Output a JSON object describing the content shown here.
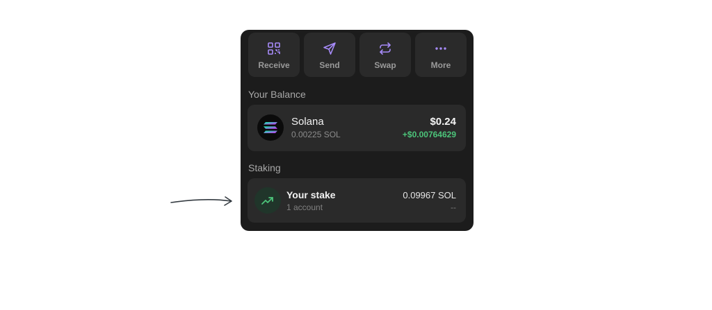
{
  "actions": [
    {
      "label": "Receive",
      "icon": "qr-code-icon"
    },
    {
      "label": "Send",
      "icon": "send-icon"
    },
    {
      "label": "Swap",
      "icon": "swap-icon"
    },
    {
      "label": "More",
      "icon": "more-icon"
    }
  ],
  "balance": {
    "title": "Your Balance",
    "token": {
      "name": "Solana",
      "amount": "0.00225 SOL",
      "value": "$0.24",
      "change": "+$0.00764629",
      "logo_icon": "solana-logo-icon"
    }
  },
  "staking": {
    "title": "Staking",
    "stake": {
      "name": "Your stake",
      "accounts": "1 account",
      "amount": "0.09967 SOL",
      "change": "--",
      "icon": "trending-up-icon"
    }
  },
  "colors": {
    "panel_bg": "#1c1c1c",
    "card_bg": "#2a2a2a",
    "accent_purple": "#a78bfa",
    "positive_green": "#4cc47a"
  },
  "annotation": {
    "icon": "hand-drawn-arrow-icon"
  }
}
